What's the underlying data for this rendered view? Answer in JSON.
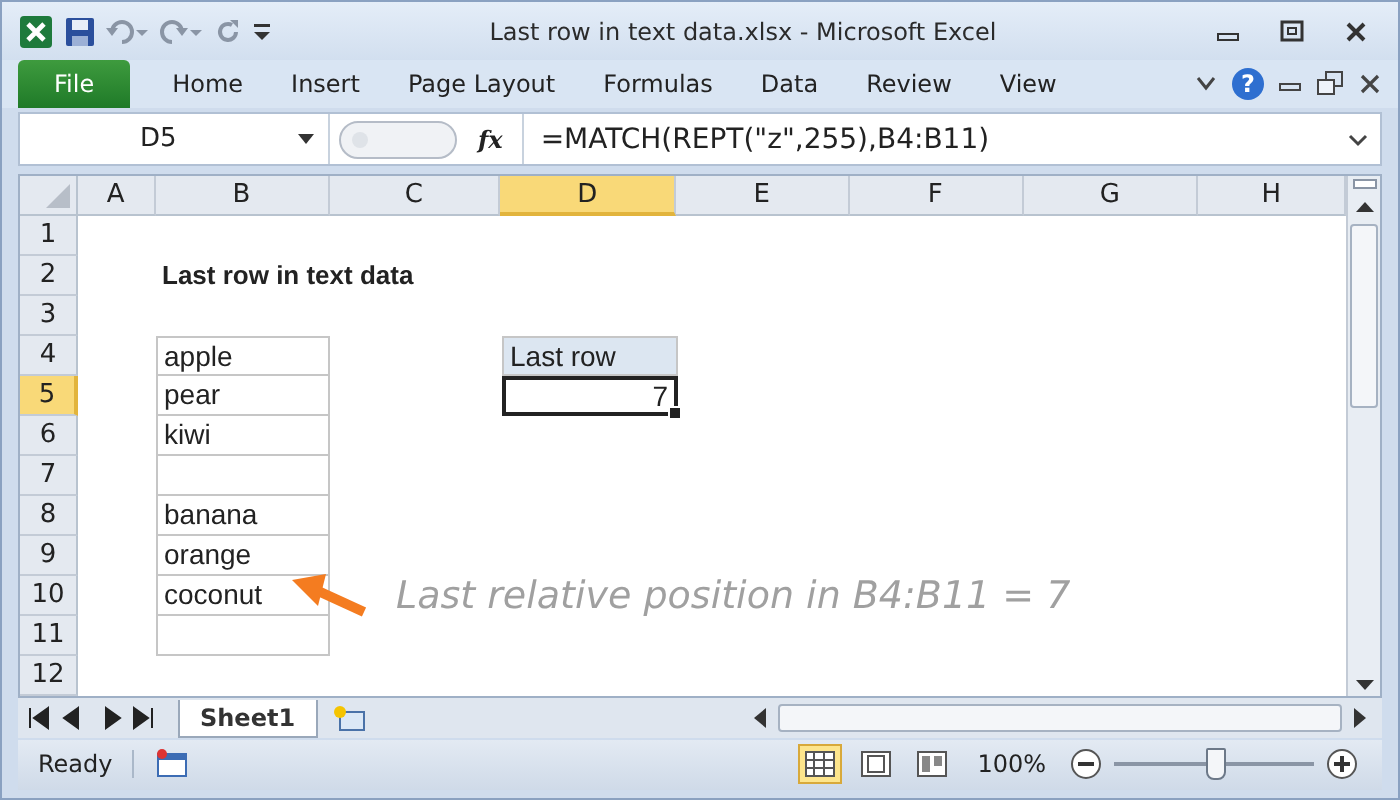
{
  "window": {
    "title": "Last row in text data.xlsx  -  Microsoft Excel"
  },
  "ribbon_tabs": [
    {
      "label": "File",
      "kind": "file",
      "selected": false
    },
    {
      "label": "Home",
      "kind": "tab",
      "selected": false
    },
    {
      "label": "Insert",
      "kind": "tab",
      "selected": false
    },
    {
      "label": "Page Layout",
      "kind": "tab",
      "selected": false
    },
    {
      "label": "Formulas",
      "kind": "tab",
      "selected": false
    },
    {
      "label": "Data",
      "kind": "tab",
      "selected": false
    },
    {
      "label": "Review",
      "kind": "tab",
      "selected": false
    },
    {
      "label": "View",
      "kind": "tab",
      "selected": false
    }
  ],
  "help": "?",
  "formula_bar": {
    "name_box": "D5",
    "function_label": "fx",
    "formula": "=MATCH(REPT(\"z\",255),B4:B11)"
  },
  "columns": [
    {
      "label": "A",
      "selected": false
    },
    {
      "label": "B",
      "selected": false
    },
    {
      "label": "C",
      "selected": false
    },
    {
      "label": "D",
      "selected": true
    },
    {
      "label": "E",
      "selected": false
    },
    {
      "label": "F",
      "selected": false
    },
    {
      "label": "G",
      "selected": false
    },
    {
      "label": "H",
      "selected": false
    }
  ],
  "rows": [
    {
      "label": "1",
      "selected": false,
      "cells": [
        null,
        null,
        null,
        null,
        null,
        null,
        null,
        null
      ]
    },
    {
      "label": "2",
      "selected": false,
      "cells": [
        null,
        {
          "text": "Last row in text data",
          "kind": "title"
        },
        null,
        null,
        null,
        null,
        null,
        null
      ]
    },
    {
      "label": "3",
      "selected": false,
      "cells": [
        null,
        null,
        null,
        null,
        null,
        null,
        null,
        null
      ]
    },
    {
      "label": "4",
      "selected": false,
      "cells": [
        null,
        {
          "text": "apple",
          "kind": "list"
        },
        null,
        {
          "text": "Last row",
          "kind": "header"
        },
        null,
        null,
        null,
        null
      ]
    },
    {
      "label": "5",
      "selected": true,
      "cells": [
        null,
        {
          "text": "pear",
          "kind": "list"
        },
        null,
        {
          "text": "7",
          "kind": "active"
        },
        null,
        null,
        null,
        null
      ]
    },
    {
      "label": "6",
      "selected": false,
      "cells": [
        null,
        {
          "text": "kiwi",
          "kind": "list"
        },
        null,
        null,
        null,
        null,
        null,
        null
      ]
    },
    {
      "label": "7",
      "selected": false,
      "cells": [
        null,
        {
          "kind": "list"
        },
        null,
        null,
        null,
        null,
        null,
        null
      ]
    },
    {
      "label": "8",
      "selected": false,
      "cells": [
        null,
        {
          "text": "banana",
          "kind": "list"
        },
        null,
        null,
        null,
        null,
        null,
        null
      ]
    },
    {
      "label": "9",
      "selected": false,
      "cells": [
        null,
        {
          "text": "orange",
          "kind": "list"
        },
        null,
        null,
        null,
        null,
        null,
        null
      ]
    },
    {
      "label": "10",
      "selected": false,
      "cells": [
        null,
        {
          "text": "coconut",
          "kind": "list"
        },
        null,
        null,
        null,
        null,
        null,
        null
      ]
    },
    {
      "label": "11",
      "selected": false,
      "cells": [
        null,
        {
          "kind": "list"
        },
        null,
        null,
        null,
        null,
        null,
        null
      ]
    },
    {
      "label": "12",
      "selected": false,
      "cells": [
        null,
        null,
        null,
        null,
        null,
        null,
        null,
        null
      ]
    }
  ],
  "annotation": "Last relative position in B4:B11 = 7",
  "sheet_tabs": [
    {
      "label": "Sheet1",
      "selected": true
    }
  ],
  "status_bar": {
    "status": "Ready",
    "views": [
      {
        "kind": "normal",
        "selected": true
      },
      {
        "kind": "layout",
        "selected": false
      },
      {
        "kind": "break",
        "selected": false
      }
    ],
    "zoom": "100%",
    "zoom_slider": {
      "level": 0.5
    }
  }
}
